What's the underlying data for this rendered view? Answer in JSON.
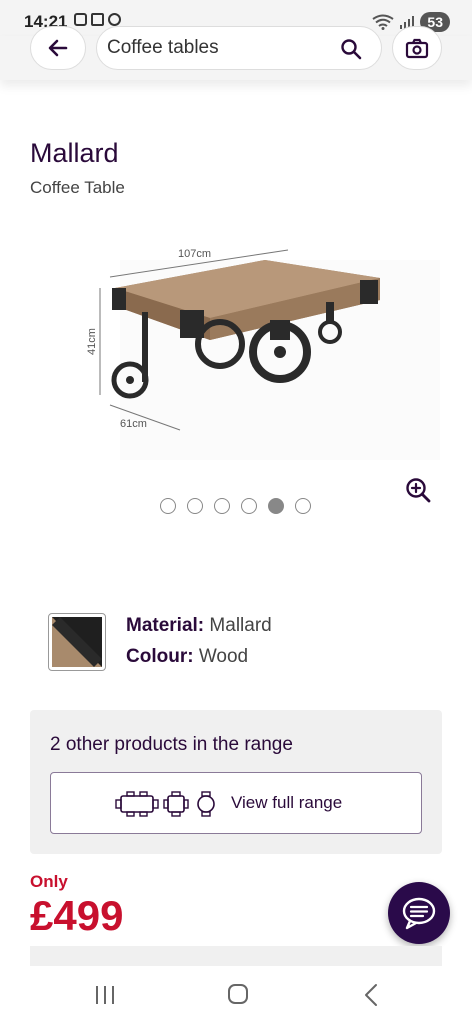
{
  "status_bar": {
    "time": "14:21",
    "battery": "53"
  },
  "header": {
    "search_value": "Coffee tables",
    "icons": [
      "back-arrow-icon",
      "search-icon",
      "camera-icon"
    ]
  },
  "product": {
    "title": "Mallard",
    "subtitle": "Coffee Table",
    "dimension_width": "107cm",
    "dimension_height": "41cm",
    "dimension_depth": "61cm",
    "carousel": {
      "total": 6,
      "active_index": 4
    }
  },
  "attributes": {
    "material_label": "Material:",
    "material_value": "Mallard",
    "colour_label": "Colour:",
    "colour_value": "Wood"
  },
  "range": {
    "title": "2 other products in the range",
    "button_label": "View full range"
  },
  "price": {
    "only_label": "Only",
    "value": "£499"
  },
  "colors": {
    "brand_purple": "#2a0a3a",
    "price_red": "#c8102e",
    "chat_button": "#2a0a4a"
  }
}
